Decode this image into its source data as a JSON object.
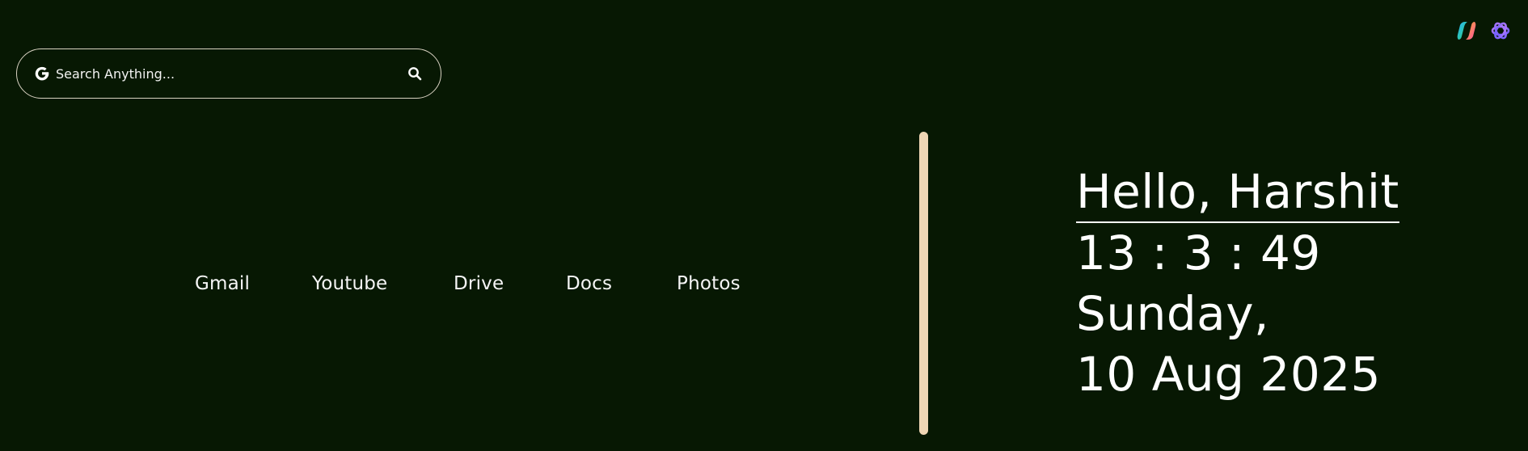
{
  "extensions": {
    "copilot_icon": "copilot-icon",
    "ai_icon": "ai-assistant-icon"
  },
  "search": {
    "placeholder": "Search Anything...",
    "engine_icon": "google-g-icon",
    "submit_icon": "search-icon"
  },
  "links": [
    {
      "label": "Gmail"
    },
    {
      "label": "Youtube"
    },
    {
      "label": "Drive"
    },
    {
      "label": "Docs"
    },
    {
      "label": "Photos"
    }
  ],
  "info": {
    "greeting": "Hello, Harshit",
    "time": "13 : 3 : 49",
    "weekday": "Sunday,",
    "date": "10 Aug 2025"
  },
  "colors": {
    "background": "#071803",
    "divider": "#efd6b4",
    "text": "#ffffff",
    "search_border": "#d9d2c2"
  }
}
